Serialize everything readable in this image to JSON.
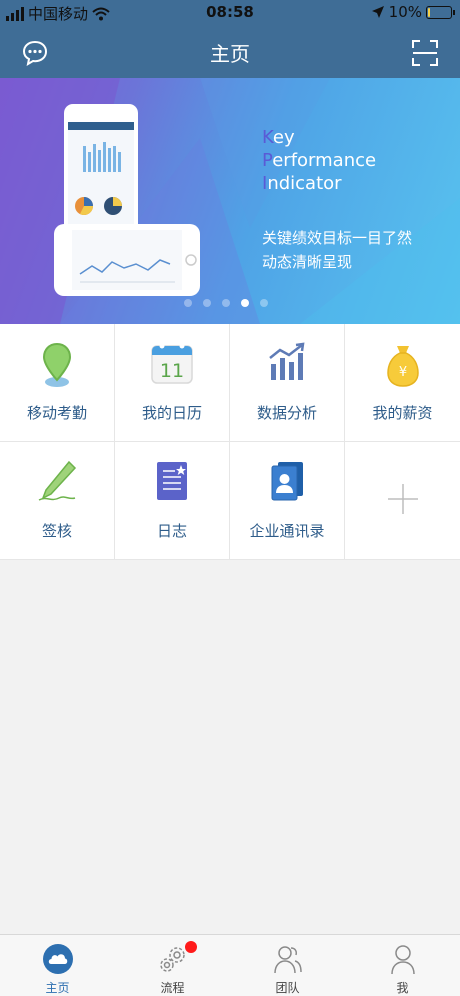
{
  "status": {
    "carrier": "中国移动",
    "time": "08:58",
    "battery": "10%",
    "battery_level": 0.1
  },
  "nav": {
    "title": "主页"
  },
  "banner": {
    "kpi_lines": [
      {
        "first": "K",
        "rest": "ey"
      },
      {
        "first": "P",
        "rest": "erformance"
      },
      {
        "first": "I",
        "rest": "ndicator"
      }
    ],
    "subtitle_line1": "关键绩效目标一目了然",
    "subtitle_line2": "动态清晰呈现",
    "page_count": 5,
    "active_page": 4
  },
  "grid": {
    "items": [
      {
        "label": "移动考勤",
        "icon": "location-pin-icon"
      },
      {
        "label": "我的日历",
        "icon": "calendar-icon",
        "calendar_day": "11"
      },
      {
        "label": "数据分析",
        "icon": "bar-chart-icon"
      },
      {
        "label": "我的薪资",
        "icon": "money-bag-icon",
        "currency": "¥"
      },
      {
        "label": "签核",
        "icon": "pen-sign-icon"
      },
      {
        "label": "日志",
        "icon": "log-book-icon"
      },
      {
        "label": "企业通讯录",
        "icon": "contacts-book-icon"
      },
      {
        "label": "",
        "icon": "add-icon"
      }
    ]
  },
  "tabs": [
    {
      "label": "主页",
      "icon": "home-cloud-icon",
      "active": true
    },
    {
      "label": "流程",
      "icon": "process-gears-icon",
      "badge": true
    },
    {
      "label": "团队",
      "icon": "team-icon"
    },
    {
      "label": "我",
      "icon": "me-icon"
    }
  ],
  "colors": {
    "nav": "#3f6d96",
    "label": "#2e5c8a",
    "active_tab": "#2d6fb0",
    "badge": "#ff1a1a"
  }
}
